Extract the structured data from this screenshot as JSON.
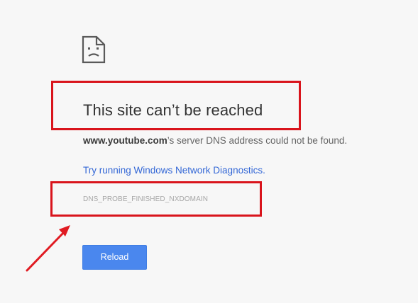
{
  "error_page": {
    "icon": "sad-page-icon",
    "title": "This site can’t be reached",
    "message": {
      "domain": "www.youtube.com",
      "rest": "’s server DNS address could not be found."
    },
    "suggestion_link": "Try running Windows Network Diagnostics.",
    "error_code": "DNS_PROBE_FINISHED_NXDOMAIN",
    "reload_label": "Reload"
  },
  "annotations": {
    "highlight_color": "#d9141c",
    "arrow_color": "#e01b22"
  },
  "colors": {
    "background": "#f7f7f7",
    "title": "#333333",
    "link": "#3367d6",
    "button": "#4a87ee",
    "error_code": "#a6a6a6"
  }
}
